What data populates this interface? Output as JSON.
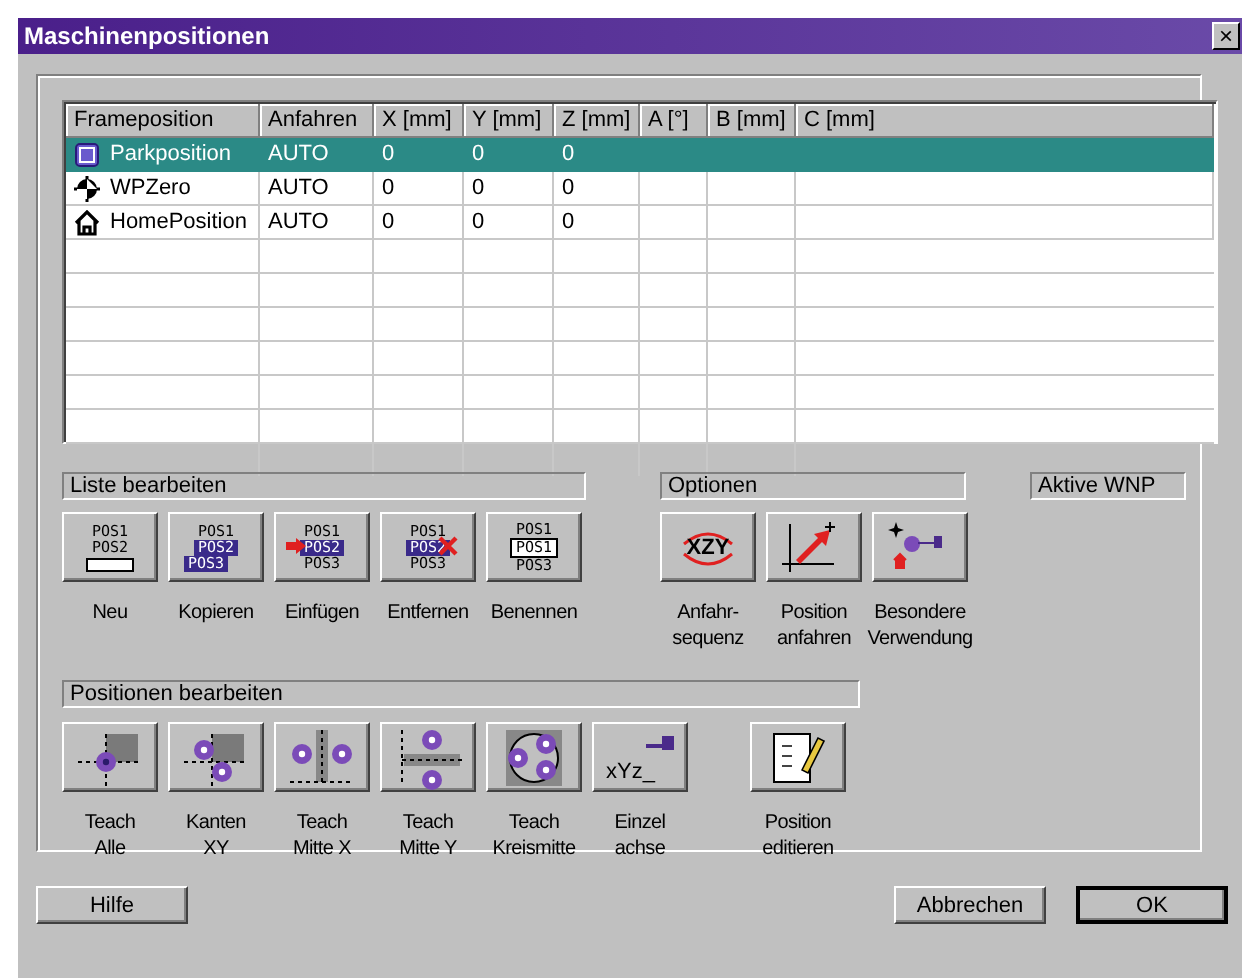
{
  "window": {
    "title": "Maschinenpositionen",
    "close": "×"
  },
  "table": {
    "columns": [
      "Frameposition",
      "Anfahren",
      "X [mm]",
      "Y [mm]",
      "Z [mm]",
      "A [°]",
      "B [mm]",
      "C [mm]"
    ],
    "rows": [
      {
        "kind": "park",
        "selected": true,
        "cells": [
          "Parkposition",
          "AUTO",
          "0",
          "0",
          "0"
        ]
      },
      {
        "kind": "zero",
        "selected": false,
        "cells": [
          "WPZero",
          "AUTO",
          "0",
          "0",
          "0"
        ]
      },
      {
        "kind": "home",
        "selected": false,
        "cells": [
          "HomePosition",
          "AUTO",
          "0",
          "0",
          "0"
        ]
      }
    ]
  },
  "list_section": {
    "title": "Liste bearbeiten",
    "buttons": [
      {
        "kind": "new",
        "label": "Neu",
        "icon_text": [
          "POS1",
          "POS2"
        ]
      },
      {
        "kind": "copy",
        "label": "Kopieren",
        "icon_text": [
          "POS1",
          "POS2",
          "POS3"
        ]
      },
      {
        "kind": "insert",
        "label": "Einfügen",
        "icon_text": [
          "POS1",
          "POS2",
          "POS3"
        ]
      },
      {
        "kind": "remove",
        "label": "Entfernen",
        "icon_text": [
          "POS1",
          "POS2",
          "POS3"
        ]
      },
      {
        "kind": "rename",
        "label": "Benennen",
        "icon_text": [
          "POS1",
          "POS1",
          "POS3"
        ]
      }
    ]
  },
  "options_section": {
    "title": "Optionen",
    "buttons": [
      {
        "kind": "sequence",
        "label": "Anfahr-\nsequenz",
        "icon_text": [
          "XZY"
        ]
      },
      {
        "kind": "approach",
        "label": "Position\nanfahren"
      },
      {
        "kind": "special",
        "label": "Besondere\nVerwendung"
      }
    ]
  },
  "active_wnp": {
    "title": "Aktive WNP"
  },
  "positions_section": {
    "title": "Positionen bearbeiten",
    "buttons": [
      {
        "kind": "all",
        "label": "Teach\nAlle"
      },
      {
        "kind": "edges",
        "label": "Kanten\nXY"
      },
      {
        "kind": "midx",
        "label": "Teach\nMitte X"
      },
      {
        "kind": "midy",
        "label": "Teach\nMitte Y"
      },
      {
        "kind": "circle",
        "label": "Teach\nKreismitte"
      },
      {
        "kind": "axis",
        "label": "Einzel\nachse",
        "icon_text": [
          "xYz_"
        ]
      },
      {
        "kind": "edit",
        "label": "Position\neditieren"
      }
    ]
  },
  "footer": {
    "buttons": [
      {
        "label": "Hilfe",
        "kind": "help"
      },
      {
        "label": "Abbrechen",
        "kind": "cancel"
      },
      {
        "label": "OK",
        "kind": "ok"
      }
    ]
  }
}
